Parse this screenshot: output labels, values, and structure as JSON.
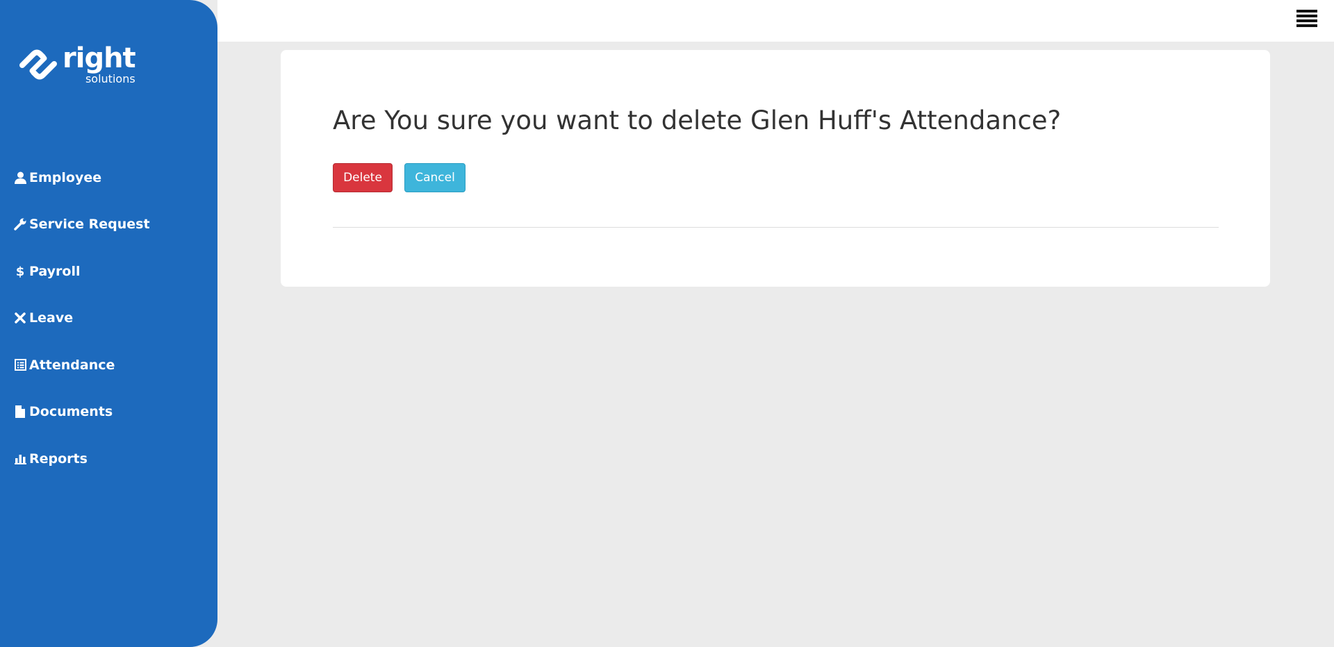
{
  "brand": {
    "name": "right",
    "tagline": "solutions"
  },
  "sidebar": {
    "items": [
      {
        "label": "Employee",
        "icon": "user-icon"
      },
      {
        "label": "Service Request",
        "icon": "wrench-icon"
      },
      {
        "label": "Payroll",
        "icon": "dollar-icon"
      },
      {
        "label": "Leave",
        "icon": "close-icon"
      },
      {
        "label": "Attendance",
        "icon": "list-icon"
      },
      {
        "label": "Documents",
        "icon": "file-icon"
      },
      {
        "label": "Reports",
        "icon": "bar-chart-icon"
      }
    ]
  },
  "topbar": {
    "menu_icon": "hamburger-menu-icon"
  },
  "dialog": {
    "title": "Are You sure you want to delete Glen Huff's Attendance?",
    "delete_label": "Delete",
    "cancel_label": "Cancel"
  },
  "colors": {
    "sidebar": "#1d6abd",
    "delete": "#d9363e",
    "cancel": "#3eb5db",
    "background": "#ebebeb"
  }
}
